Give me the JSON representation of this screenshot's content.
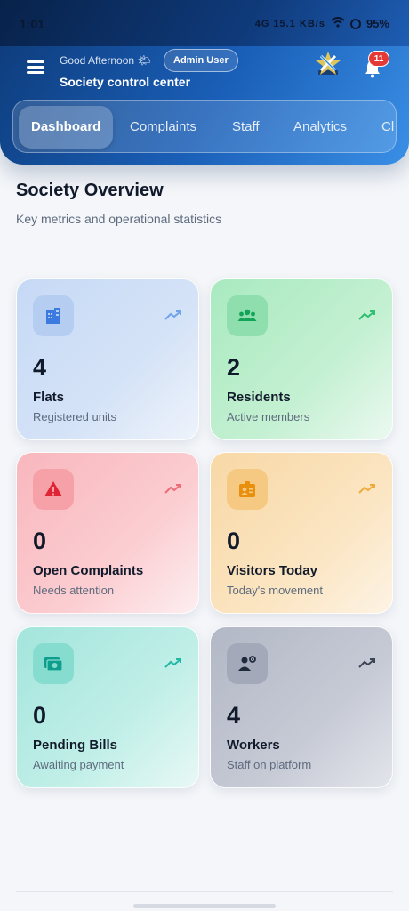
{
  "status_bar": {
    "time": "1:01",
    "indicators": "4G 15.1 KB/s",
    "battery": "95%"
  },
  "header": {
    "greeting": "Good Afternoon 🌤",
    "role_badge": "Admin User",
    "subtitle": "Society control center",
    "notification_count": "11"
  },
  "tabs": [
    {
      "label": "Dashboard",
      "active": true
    },
    {
      "label": "Complaints",
      "active": false
    },
    {
      "label": "Staff",
      "active": false
    },
    {
      "label": "Analytics",
      "active": false
    },
    {
      "label": "Cl",
      "active": false
    }
  ],
  "overview": {
    "title": "Society Overview",
    "subtitle": "Key metrics and operational statistics"
  },
  "cards": [
    {
      "value": "4",
      "label": "Flats",
      "description": "Registered units",
      "icon": "building-icon",
      "accent": "#3b7be0"
    },
    {
      "value": "2",
      "label": "Residents",
      "description": "Active members",
      "icon": "people-icon",
      "accent": "#1fb865"
    },
    {
      "value": "0",
      "label": "Open Complaints",
      "description": "Needs attention",
      "icon": "warning-icon",
      "accent": "#e53945"
    },
    {
      "value": "0",
      "label": "Visitors Today",
      "description": "Today's movement",
      "icon": "id-badge-icon",
      "accent": "#f29e1c"
    },
    {
      "value": "0",
      "label": "Pending Bills",
      "description": "Awaiting payment",
      "icon": "bill-icon",
      "accent": "#14b8a6"
    },
    {
      "value": "4",
      "label": "Workers",
      "description": "Staff on platform",
      "icon": "worker-icon",
      "accent": "#334155"
    }
  ]
}
